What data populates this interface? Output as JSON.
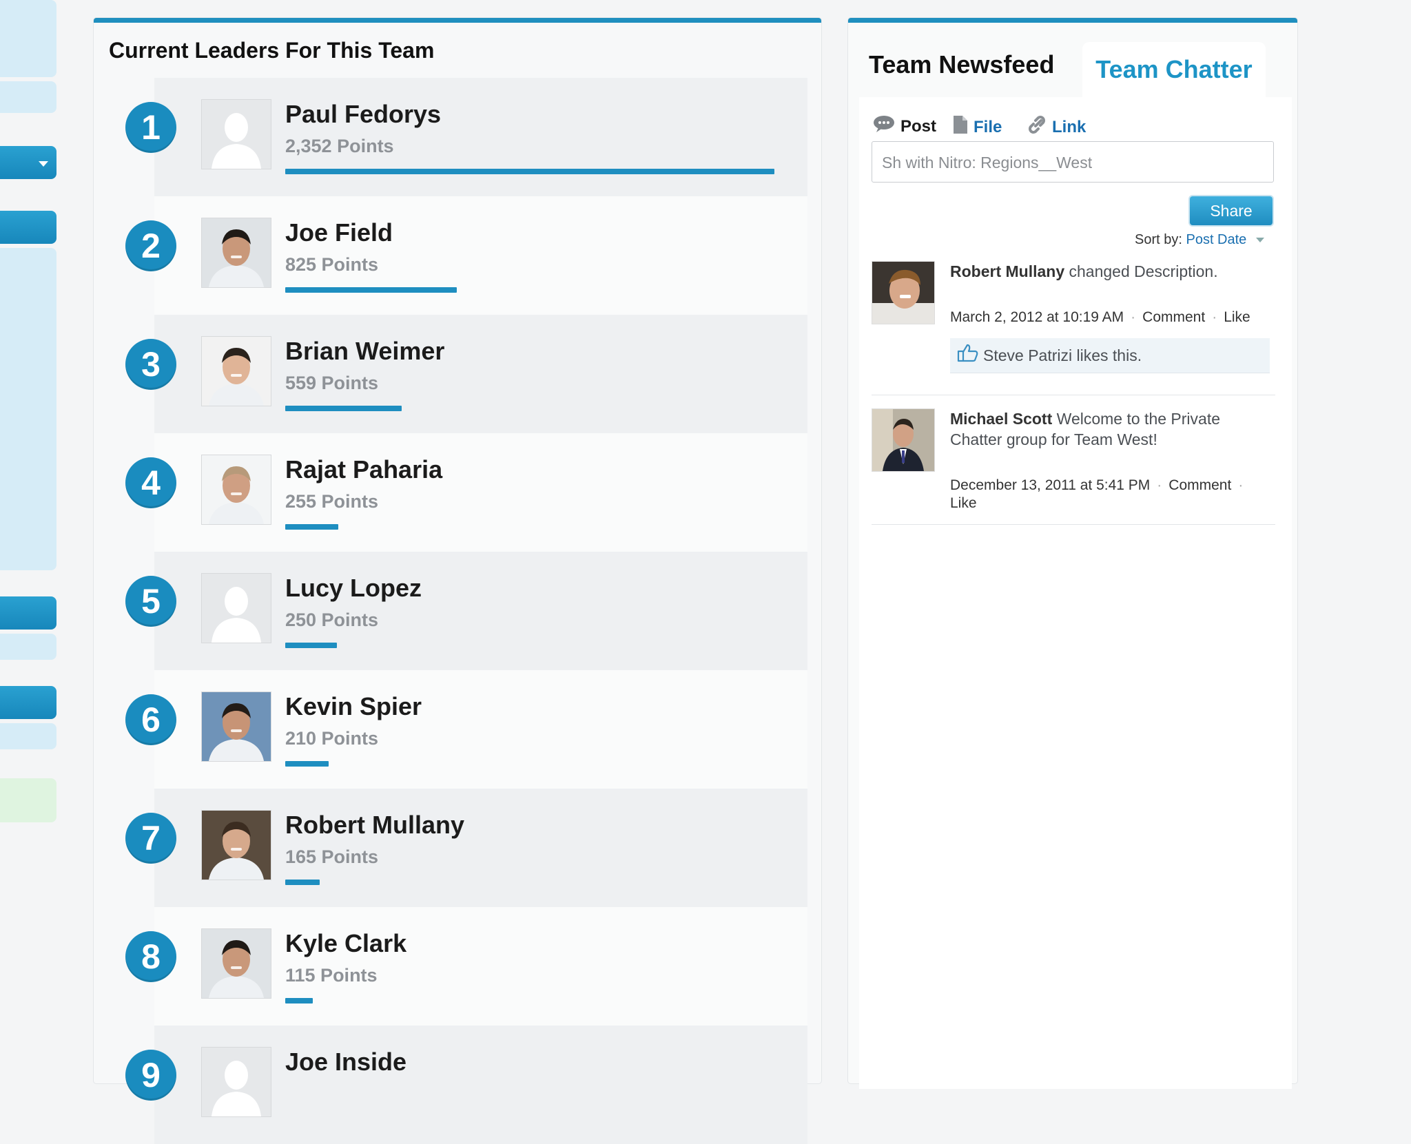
{
  "leaders_panel": {
    "title": "Current Leaders For This Team",
    "bar_color": "#1e8ec0",
    "rank_color": "#1a8cbf",
    "leaders": [
      {
        "rank": "1",
        "name": "Paul Fedorys",
        "points": "2,352 Points",
        "progress": 1.0,
        "avatar": "default-avatar"
      },
      {
        "rank": "2",
        "name": "Joe Field",
        "points": "825 Points",
        "progress": 0.351,
        "avatar": "photo"
      },
      {
        "rank": "3",
        "name": "Brian Weimer",
        "points": "559 Points",
        "progress": 0.238,
        "avatar": "photo"
      },
      {
        "rank": "4",
        "name": "Rajat Paharia",
        "points": "255 Points",
        "progress": 0.108,
        "avatar": "photo"
      },
      {
        "rank": "5",
        "name": "Lucy Lopez",
        "points": "250 Points",
        "progress": 0.106,
        "avatar": "default-avatar"
      },
      {
        "rank": "6",
        "name": "Kevin Spier",
        "points": "210 Points",
        "progress": 0.089,
        "avatar": "photo"
      },
      {
        "rank": "7",
        "name": "Robert Mullany",
        "points": "165 Points",
        "progress": 0.07,
        "avatar": "photo"
      },
      {
        "rank": "8",
        "name": "Kyle Clark",
        "points": "115 Points",
        "progress": 0.049,
        "avatar": "photo"
      },
      {
        "rank": "9",
        "name": "Joe Inside",
        "points": "",
        "progress": 0,
        "avatar": "default-avatar"
      }
    ]
  },
  "feed_panel": {
    "tab_newsfeed": "Team Newsfeed",
    "tab_chatter": "Team Chatter",
    "publisher": {
      "post": "Post",
      "file": "File",
      "link": "Link"
    },
    "share_input_value": "Sh   with Nitro: Regions__West",
    "share_button": "Share",
    "sort_label": "Sort by:",
    "sort_value": "Post Date",
    "items": [
      {
        "author": "Robert Mullany",
        "text": " changed Description.",
        "date": "March 2, 2012 at 10:19 AM",
        "comment": "Comment",
        "like": "Like",
        "likes": "Steve Patrizi likes this."
      },
      {
        "author": "Michael Scott",
        "text": " Welcome to the Private Chatter group for Team West!",
        "date": "December 13, 2011 at 5:41 PM",
        "comment": "Comment",
        "like": "Like"
      }
    ]
  }
}
